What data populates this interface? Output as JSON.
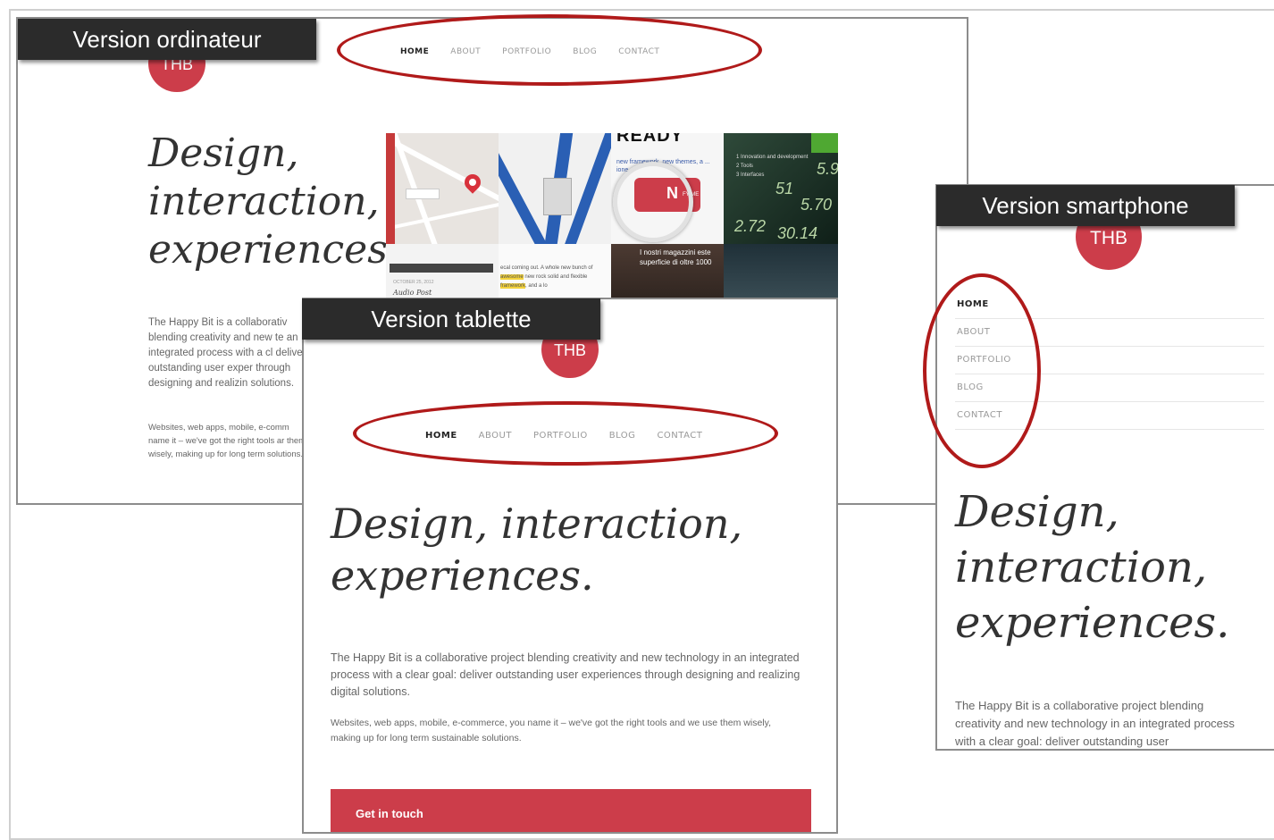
{
  "colors": {
    "brand_red": "#cc3d4a",
    "annotation_red": "#b01a1a",
    "label_bg": "#2b2b2b"
  },
  "labels": {
    "desktop": "Version ordinateur",
    "tablet": "Version tablette",
    "phone": "Version smartphone"
  },
  "site": {
    "logo": "THB",
    "nav": [
      "HOME",
      "ABOUT",
      "PORTFOLIO",
      "BLOG",
      "CONTACT"
    ],
    "hero_desktop": [
      "Design,",
      "interaction,",
      "experiences."
    ],
    "hero_tablet": [
      "Design, interaction,",
      "experiences."
    ],
    "hero_phone": [
      "Design,",
      "interaction,",
      "experiences."
    ],
    "desktop_p1": "The Happy Bit is a collaborativ blending creativity and new te an integrated process with a cl deliver outstanding user exper through designing and realizin solutions.",
    "desktop_p2": "Websites, web apps, mobile, e-comm name it – we've got the right tools ar them wisely, making up for long term solutions.",
    "tablet_p1": "The Happy Bit is a collaborative project blending creativity and new technology in an integrated process with a clear goal: deliver outstanding user experiences through designing and realizing digital solutions.",
    "tablet_p2": "Websites, web apps, mobile, e-commerce, you name it – we've got the right tools and we use them wisely, making up for long term sustainable solutions.",
    "phone_p1": "The Happy Bit is a collaborative project blending creativity and new technology in an integrated process with a clear goal: deliver outstanding user",
    "cta": "Get in touch"
  },
  "portfolio": {
    "t3_big": "READY",
    "t3_small": "new framework, new themes, a ... ione",
    "t3_btn": "N",
    "t3_btn_small": "FY ME",
    "t4_items": [
      "1  Innovation and development",
      "2  Tools",
      "3  Interfaces"
    ],
    "t4_nums": [
      "5.9",
      "51",
      "5.70",
      "2.72",
      "30.14"
    ],
    "t5_caption": "OCTOBER 25, 2012",
    "t5_title": "Audio Post",
    "t6_text_a": "ecal coming out. A whole new bunch of",
    "t6_hl": "awesome",
    "t6_text_b": "new rock solid and flexible",
    "t6_hl2": "framework",
    "t6_text_c": ", and a lo",
    "t7_text": "I nostri magazzini este superficie di oltre 1000"
  }
}
